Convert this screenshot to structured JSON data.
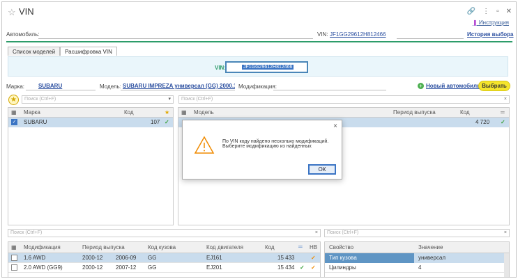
{
  "window": {
    "title": "VIN",
    "help_link": "Инструкция",
    "icons": [
      "link-icon",
      "more-icon",
      "restore-icon",
      "close-icon"
    ]
  },
  "header": {
    "car_label": "Автомобиль:",
    "vin_label": "VIN:",
    "vin_value": "JF1GG29612H812466",
    "history_link": "История выбора"
  },
  "tabs": [
    {
      "label": "Список моделей"
    },
    {
      "label": "Расшифровка VIN"
    }
  ],
  "vin_panel": {
    "label": "VIN:",
    "value": "JF1GG29612H812466"
  },
  "filters": {
    "brand_label": "Марка:",
    "brand_value": "SUBARU",
    "model_label": "Модель:",
    "model_value": "SUBARU IMPREZA универсал (GG) 2000.10 - ...",
    "mod_label": "Модификация:",
    "new_car": "Новый автомобиль",
    "choose": "Выбрать"
  },
  "search": {
    "placeholder": "Поиск (Ctrl+F)"
  },
  "brands_table": {
    "headers": [
      "Марка",
      "Код"
    ],
    "rows": [
      {
        "name": "SUBARU",
        "code": "107"
      }
    ]
  },
  "models_table": {
    "headers": [
      "Модель",
      "Период выпуска",
      "Код"
    ],
    "rows": [
      {
        "code": "4 720"
      }
    ]
  },
  "dialog": {
    "line1": "По VIN коду найдено несколько модификаций.",
    "line2": "Выберите модификацию из найденных",
    "ok": "ОК"
  },
  "mods_table": {
    "headers": [
      "Модификация",
      "Период выпуска",
      "Код кузова",
      "Код двигателя",
      "Код",
      "НВ"
    ],
    "rows": [
      {
        "name": "1.6 AWD",
        "from": "2000-12",
        "to": "2006-09",
        "body": "GG",
        "engine": "EJ161",
        "code": "15 433"
      },
      {
        "name": "2.0 AWD (GG9)",
        "from": "2000-12",
        "to": "2007-12",
        "body": "GG",
        "engine": "EJ201",
        "code": "15 434"
      }
    ]
  },
  "props_table": {
    "headers": [
      "Свойство",
      "Значение"
    ],
    "rows": [
      {
        "prop": "Тип кузова",
        "val": "универсал"
      },
      {
        "prop": "Цилиндры",
        "val": "4"
      }
    ]
  },
  "colors": {
    "accent_green": "#2d9c6a",
    "link": "#2b4fa0",
    "selected": "#3a74c4",
    "button_yellow": "#f5e52c"
  }
}
